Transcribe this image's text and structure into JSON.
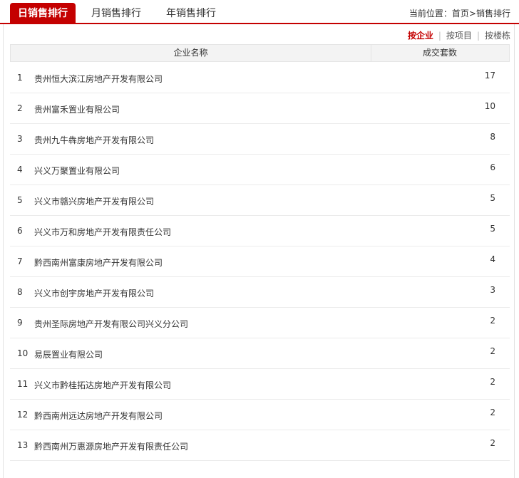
{
  "tabs": [
    {
      "label": "日销售排行"
    },
    {
      "label": "月销售排行"
    },
    {
      "label": "年销售排行"
    }
  ],
  "breadcrumb": {
    "prefix": "当前位置：",
    "home": "首页",
    "separator": ">",
    "current": "销售排行"
  },
  "filters": {
    "by_company": "按企业",
    "separator": "|",
    "by_project": "按项目",
    "by_building": "按楼栋"
  },
  "table": {
    "headers": {
      "name": "企业名称",
      "count": "成交套数"
    },
    "rows": [
      {
        "rank": "1",
        "name": "贵州恒大滨江房地产开发有限公司",
        "count": "17"
      },
      {
        "rank": "2",
        "name": "贵州富禾置业有限公司",
        "count": "10"
      },
      {
        "rank": "3",
        "name": "贵州九牛犇房地产开发有限公司",
        "count": "8"
      },
      {
        "rank": "4",
        "name": "兴义万聚置业有限公司",
        "count": "6"
      },
      {
        "rank": "5",
        "name": "兴义市赣兴房地产开发有限公司",
        "count": "5"
      },
      {
        "rank": "6",
        "name": "兴义市万和房地产开发有限责任公司",
        "count": "5"
      },
      {
        "rank": "7",
        "name": "黔西南州富康房地产开发有限公司",
        "count": "4"
      },
      {
        "rank": "8",
        "name": "兴义市创宇房地产开发有限公司",
        "count": "3"
      },
      {
        "rank": "9",
        "name": "贵州圣际房地产开发有限公司兴义分公司",
        "count": "2"
      },
      {
        "rank": "10",
        "name": "易辰置业有限公司",
        "count": "2"
      },
      {
        "rank": "11",
        "name": "兴义市黔桂拓达房地产开发有限公司",
        "count": "2"
      },
      {
        "rank": "12",
        "name": "黔西南州远达房地产开发有限公司",
        "count": "2"
      },
      {
        "rank": "13",
        "name": "黔西南州万惠源房地产开发有限责任公司",
        "count": "2"
      }
    ]
  },
  "colors": {
    "accent": "#c40000"
  }
}
